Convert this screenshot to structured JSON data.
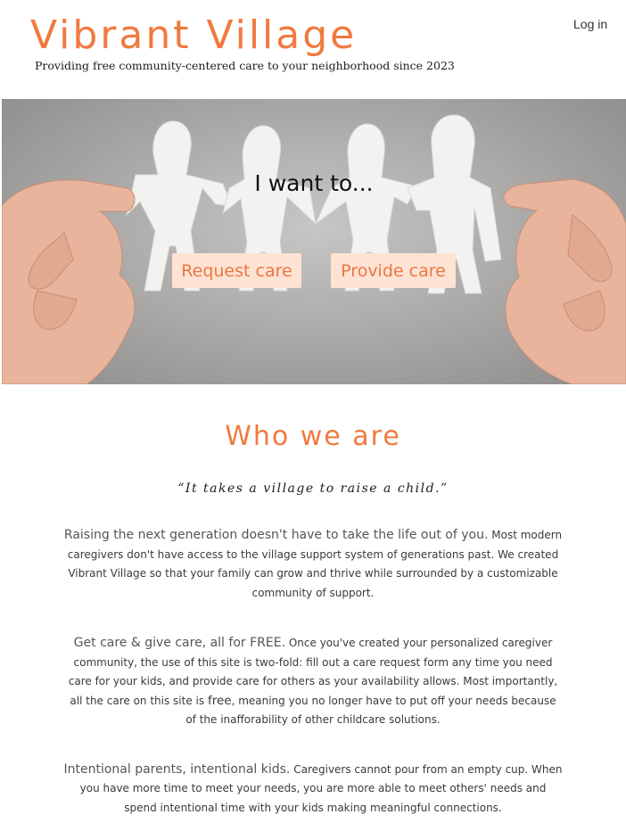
{
  "header": {
    "brand": "Vibrant Village",
    "tagline": "Providing free community-centered care to your neighborhood since 2023",
    "login_label": "Log in"
  },
  "hero": {
    "heading": "I want to...",
    "request_label": "Request care",
    "provide_label": "Provide care"
  },
  "about": {
    "title": "Who we are",
    "quote": "“It takes a village to raise a child.”",
    "p1_lead": "Raising the next generation doesn't have to take the life out of you.",
    "p1_body": " Most modern caregivers don't have access to the village support system of generations past. We created Vibrant Village so that your family can grow and thrive while surrounded by a customizable community of support.",
    "p2_lead": "Get care & give care, all for FREE.",
    "p2_body_a": " Once you've created your personalized caregiver community, the use of this site is two-fold: fill out a care request form any time you need care for your kids, and provide care for others as your availability allows. Most importantly, all the care on this site is ",
    "p2_emph": "free",
    "p2_body_b": ", meaning you no longer have to put off your needs because of the inafforability of other childcare solutions.",
    "p3_lead": "Intentional parents, intentional kids.",
    "p3_body": " Caregivers cannot pour from an empty cup. When you have more time to meet your needs, you are more able to meet others' needs and spend intentional time with your kids making meaningful connections."
  },
  "colors": {
    "accent": "#f07a3f",
    "button_bg": "#fde3d4",
    "button_text": "#ef7541"
  },
  "icons": {
    "hero_image": "paper-doll-chain-held-by-hands"
  }
}
